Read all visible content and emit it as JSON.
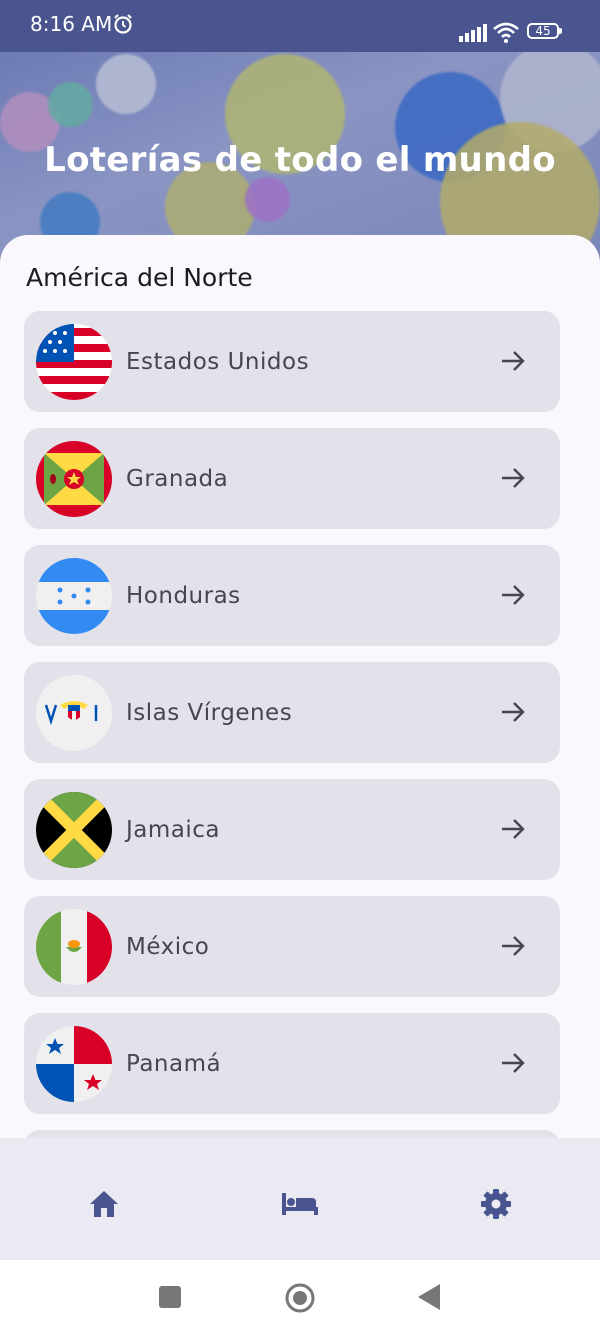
{
  "status_bar": {
    "time": "8:16 AM",
    "battery": "45",
    "icons": [
      "alarm-icon",
      "signal-icon",
      "wifi-icon",
      "battery-icon"
    ]
  },
  "header": {
    "title": "Loterías de todo el mundo"
  },
  "section": {
    "title": "América del Norte"
  },
  "countries": [
    {
      "name": "Estados Unidos",
      "flag": "usa-flag-icon"
    },
    {
      "name": "Granada",
      "flag": "grenada-flag-icon"
    },
    {
      "name": "Honduras",
      "flag": "honduras-flag-icon"
    },
    {
      "name": "Islas Vírgenes",
      "flag": "virgin-islands-flag-icon"
    },
    {
      "name": "Jamaica",
      "flag": "jamaica-flag-icon"
    },
    {
      "name": "México",
      "flag": "mexico-flag-icon"
    },
    {
      "name": "Panamá",
      "flag": "panama-flag-icon"
    }
  ],
  "bottom_nav": {
    "items": [
      "home-icon",
      "bed-icon",
      "settings-icon"
    ],
    "active": "home-icon"
  },
  "system_nav": [
    "recents-button",
    "home-button",
    "back-button"
  ],
  "colors": {
    "status_bar": "#4a5590",
    "card": "#e3e1ea",
    "nav_icon": "#4a5590",
    "text": "#45464f"
  }
}
